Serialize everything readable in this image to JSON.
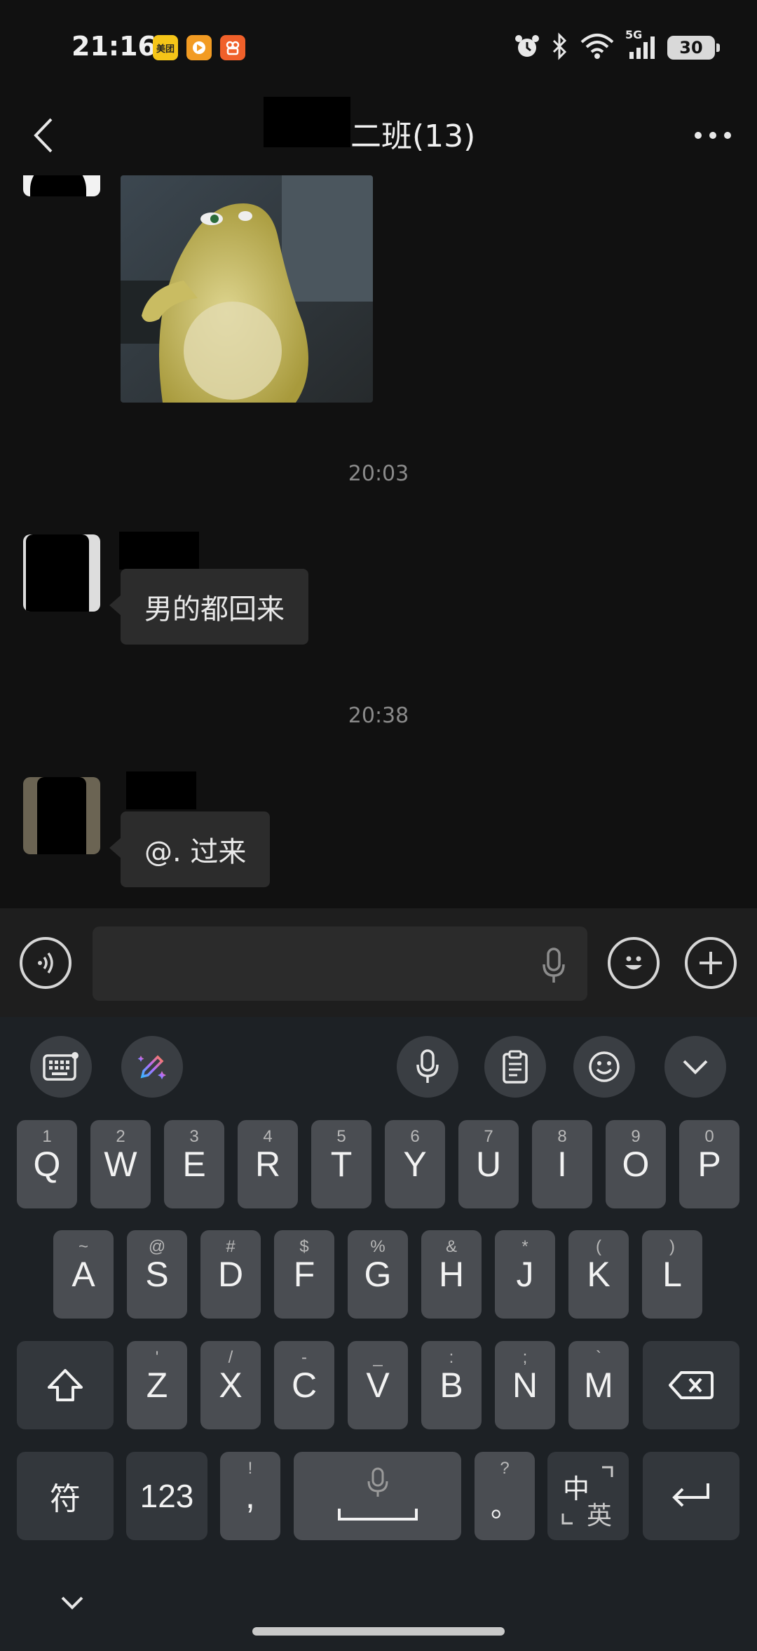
{
  "status_bar": {
    "time": "21:16",
    "app_icons": [
      {
        "name": "meituan-app-icon",
        "label": "美团",
        "color": "#f5c518"
      },
      {
        "name": "video-app-icon",
        "label": "",
        "color": "#f29b23"
      },
      {
        "name": "kuaishou-app-icon",
        "label": "",
        "color": "#f0602a"
      }
    ],
    "network": "5G",
    "battery": "30"
  },
  "header": {
    "title": "二班(13)",
    "back_icon": "chevron-left-icon",
    "more_icon": "more-dots-icon"
  },
  "messages": [
    {
      "type": "image",
      "description_icon": "sticker-image"
    },
    {
      "type": "timestamp",
      "text": "20:03"
    },
    {
      "type": "text",
      "text": "男的都回来"
    },
    {
      "type": "timestamp",
      "text": "20:38"
    },
    {
      "type": "text",
      "text": "@. 过来"
    }
  ],
  "input_bar": {
    "placeholder": "",
    "voice_icon": "voice-mode-icon",
    "mic_icon": "microphone-icon",
    "emoji_icon": "emoji-icon",
    "plus_icon": "plus-icon"
  },
  "keyboard": {
    "toolbar": [
      "keyboard-switch-icon",
      "ai-pen-icon",
      "microphone-icon",
      "clipboard-icon",
      "emoji-icon",
      "chevron-down-icon"
    ],
    "row1": [
      {
        "main": "Q",
        "sub": "1"
      },
      {
        "main": "W",
        "sub": "2"
      },
      {
        "main": "E",
        "sub": "3"
      },
      {
        "main": "R",
        "sub": "4"
      },
      {
        "main": "T",
        "sub": "5"
      },
      {
        "main": "Y",
        "sub": "6"
      },
      {
        "main": "U",
        "sub": "7"
      },
      {
        "main": "I",
        "sub": "8"
      },
      {
        "main": "O",
        "sub": "9"
      },
      {
        "main": "P",
        "sub": "0"
      }
    ],
    "row2": [
      {
        "main": "A",
        "sub": "~"
      },
      {
        "main": "S",
        "sub": "@"
      },
      {
        "main": "D",
        "sub": "#"
      },
      {
        "main": "F",
        "sub": "$"
      },
      {
        "main": "G",
        "sub": "%"
      },
      {
        "main": "H",
        "sub": "&"
      },
      {
        "main": "J",
        "sub": "*"
      },
      {
        "main": "K",
        "sub": "("
      },
      {
        "main": "L",
        "sub": ")"
      }
    ],
    "row3": [
      {
        "main": "Z",
        "sub": "'"
      },
      {
        "main": "X",
        "sub": "/"
      },
      {
        "main": "C",
        "sub": "-"
      },
      {
        "main": "V",
        "sub": "_"
      },
      {
        "main": "B",
        "sub": ":"
      },
      {
        "main": "N",
        "sub": ";"
      },
      {
        "main": "M",
        "sub": "`"
      }
    ],
    "symbols_label": "符",
    "numbers_label": "123",
    "comma_key": {
      "main": ",",
      "sub": "!"
    },
    "period_key": {
      "main": "。",
      "sub": "?"
    },
    "lang_key": {
      "top": "中",
      "bottom": "英"
    }
  }
}
